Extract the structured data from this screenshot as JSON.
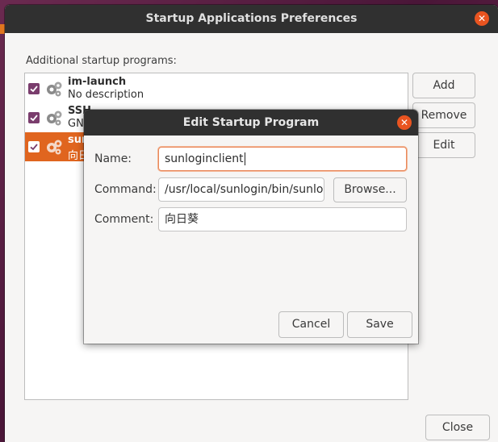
{
  "window": {
    "title": "Startup Applications Preferences",
    "section_label": "Additional startup programs:",
    "close_label": "Close"
  },
  "programs": [
    {
      "name": "im-launch",
      "description": "No description",
      "checked": true,
      "selected": false
    },
    {
      "name": "SSH",
      "description": "GNO",
      "checked": true,
      "selected": false
    },
    {
      "name": "sun",
      "description": "向日",
      "checked": true,
      "selected": true
    }
  ],
  "actions": {
    "add": "Add",
    "remove": "Remove",
    "edit": "Edit"
  },
  "dialog": {
    "title": "Edit Startup Program",
    "name_label": "Name:",
    "command_label": "Command:",
    "comment_label": "Comment:",
    "name_value": "sunloginclient",
    "command_value": "/usr/local/sunlogin/bin/sunlog",
    "comment_value": "向日葵",
    "browse": "Browse...",
    "cancel": "Cancel",
    "save": "Save"
  },
  "colors": {
    "accent": "#e95420",
    "selection": "#e0651f",
    "checkbox": "#7a3d6d",
    "titlebar": "#303030"
  },
  "icons": {
    "close": "close-icon",
    "check": "checkmark-icon",
    "program": "gears-icon"
  }
}
